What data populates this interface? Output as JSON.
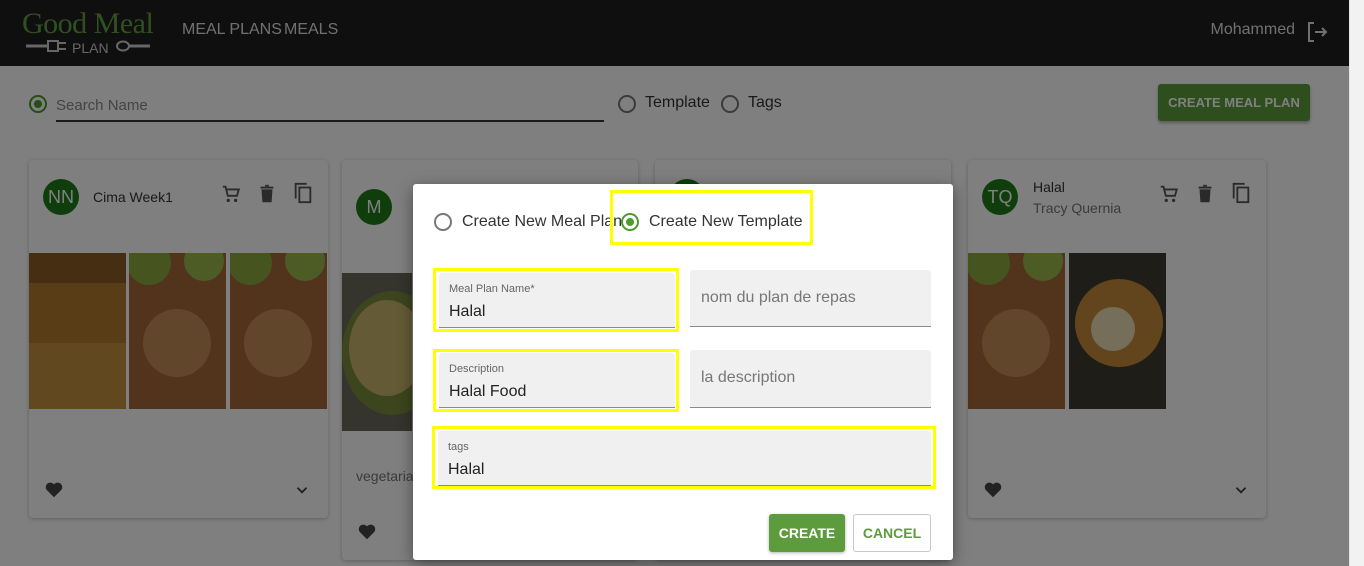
{
  "header": {
    "logo_title": "Good Meal",
    "logo_sub": "PLAN",
    "nav": [
      "MEAL PLANS",
      "MEALS"
    ],
    "user_name": "Mohammed"
  },
  "search": {
    "placeholder": "Search Name",
    "filter_options": [
      "Template",
      "Tags"
    ],
    "create_button": "CREATE MEAL PLAN"
  },
  "cards": [
    {
      "initials": "NN",
      "title": "Cima Week1",
      "subtitle": ""
    },
    {
      "initials": "M",
      "title": "",
      "subtitle": "",
      "footer_text": "vegetarian"
    },
    {
      "initials": "",
      "title": "",
      "subtitle": ""
    },
    {
      "initials": "TQ",
      "title": "Halal",
      "subtitle": "Tracy Quernia"
    }
  ],
  "dialog": {
    "mode_options": [
      "Create New Meal Plan",
      "Create New Template"
    ],
    "selected_mode": "Create New Template",
    "fields": {
      "name": {
        "label": "Meal Plan Name*",
        "value": "Halal",
        "alt_placeholder": "nom du plan de repas"
      },
      "description": {
        "label": "Description",
        "value": "Halal Food",
        "alt_placeholder": "la description"
      },
      "tags": {
        "label": "tags",
        "value": "Halal"
      }
    },
    "create_button": "CREATE",
    "cancel_button": "CANCEL"
  },
  "colors": {
    "brand_green": "#5c9c3c",
    "avatar_green": "#1f7d18",
    "highlight": "#ffff00",
    "topbar": "#1e1e1e"
  }
}
